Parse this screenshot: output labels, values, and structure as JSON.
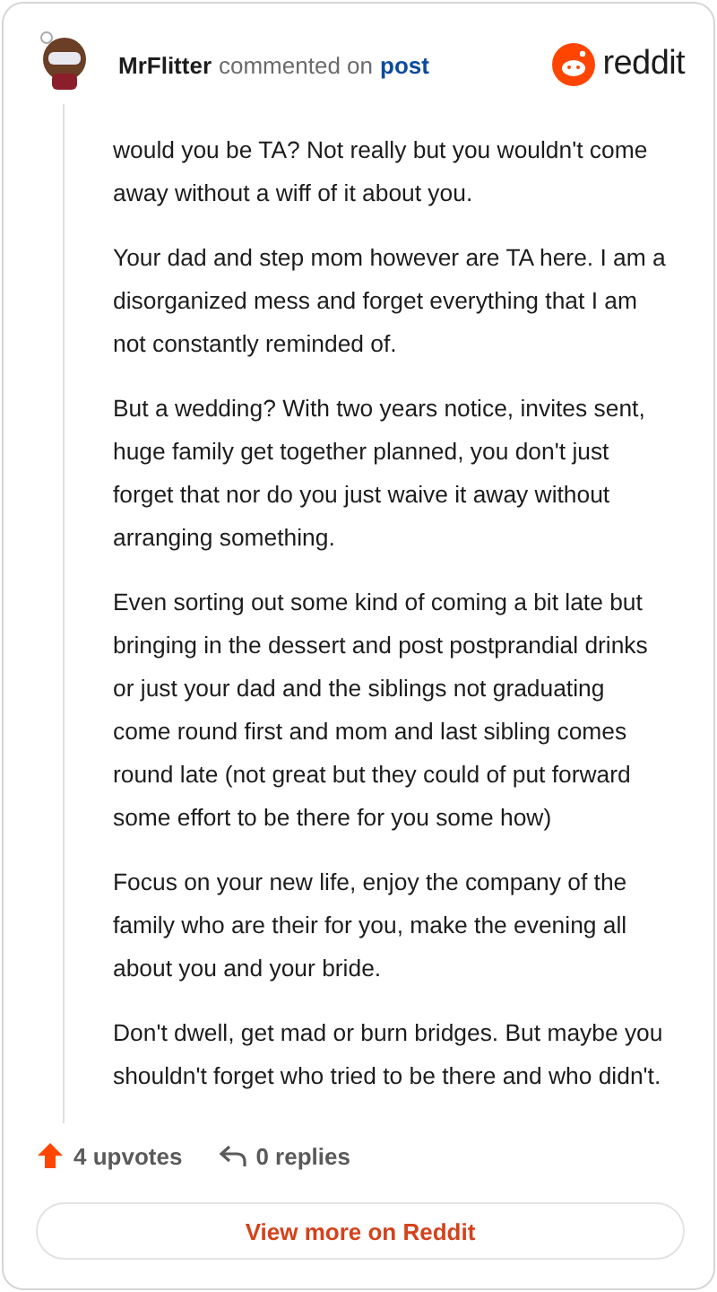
{
  "header": {
    "author": "MrFlitter",
    "action": "commented on",
    "link": "post",
    "logo_text": "reddit"
  },
  "paragraphs": [
    "would you be TA? Not really but you wouldn't come away without a wiff of it about you.",
    "Your dad and step mom however are TA here. I am a disorganized mess and forget everything that I am not constantly reminded of.",
    "But a wedding? With two years notice, invites sent, huge family get together planned, you don't just forget that nor do you just waive it away without arranging something.",
    "Even sorting out some kind of coming a bit late but bringing in the dessert and post postprandial drinks or just your dad and the siblings not graduating come round first and mom and last sibling comes round late (not great but they could of put forward some effort to be there for you some how)",
    "Focus on your new life, enjoy the company of the family who are their for you, make the evening all about you and your bride.",
    "Don't dwell, get mad or burn bridges. But maybe you shouldn't forget who tried to be there and who didn't."
  ],
  "footer": {
    "upvotes": "4 upvotes",
    "replies": "0 replies",
    "button": "View more on Reddit"
  }
}
